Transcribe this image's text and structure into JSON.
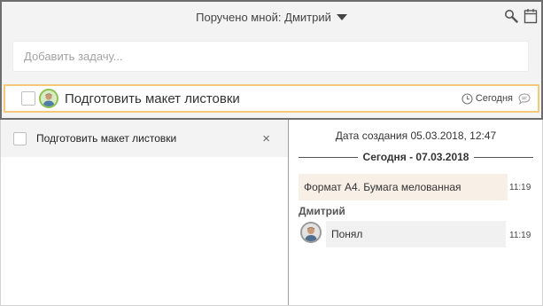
{
  "header": {
    "filter_label": "Поручено мной: Дмитрий"
  },
  "add_task": {
    "placeholder": "Добавить задачу..."
  },
  "task": {
    "title": "Подготовить макет листовки",
    "due": "Сегодня"
  },
  "detail": {
    "title": "Подготовить макет листовки",
    "close_label": "×",
    "created": "Дата создания 05.03.2018, 12:47",
    "day_separator": "Сегодня - 07.03.2018",
    "messages": [
      {
        "text": "Формат А4. Бумага мелованная",
        "time": "11:19"
      },
      {
        "author": "Дмитрий",
        "text": "Понял",
        "time": "11:19"
      }
    ]
  },
  "colors": {
    "accent_border": "#f6c87a",
    "avatar_ring": "#8cc34f",
    "message_highlight": "#f8efe6"
  },
  "icons": [
    "search-icon",
    "calendar-icon",
    "clock-icon",
    "comment-icon",
    "user-avatar"
  ]
}
